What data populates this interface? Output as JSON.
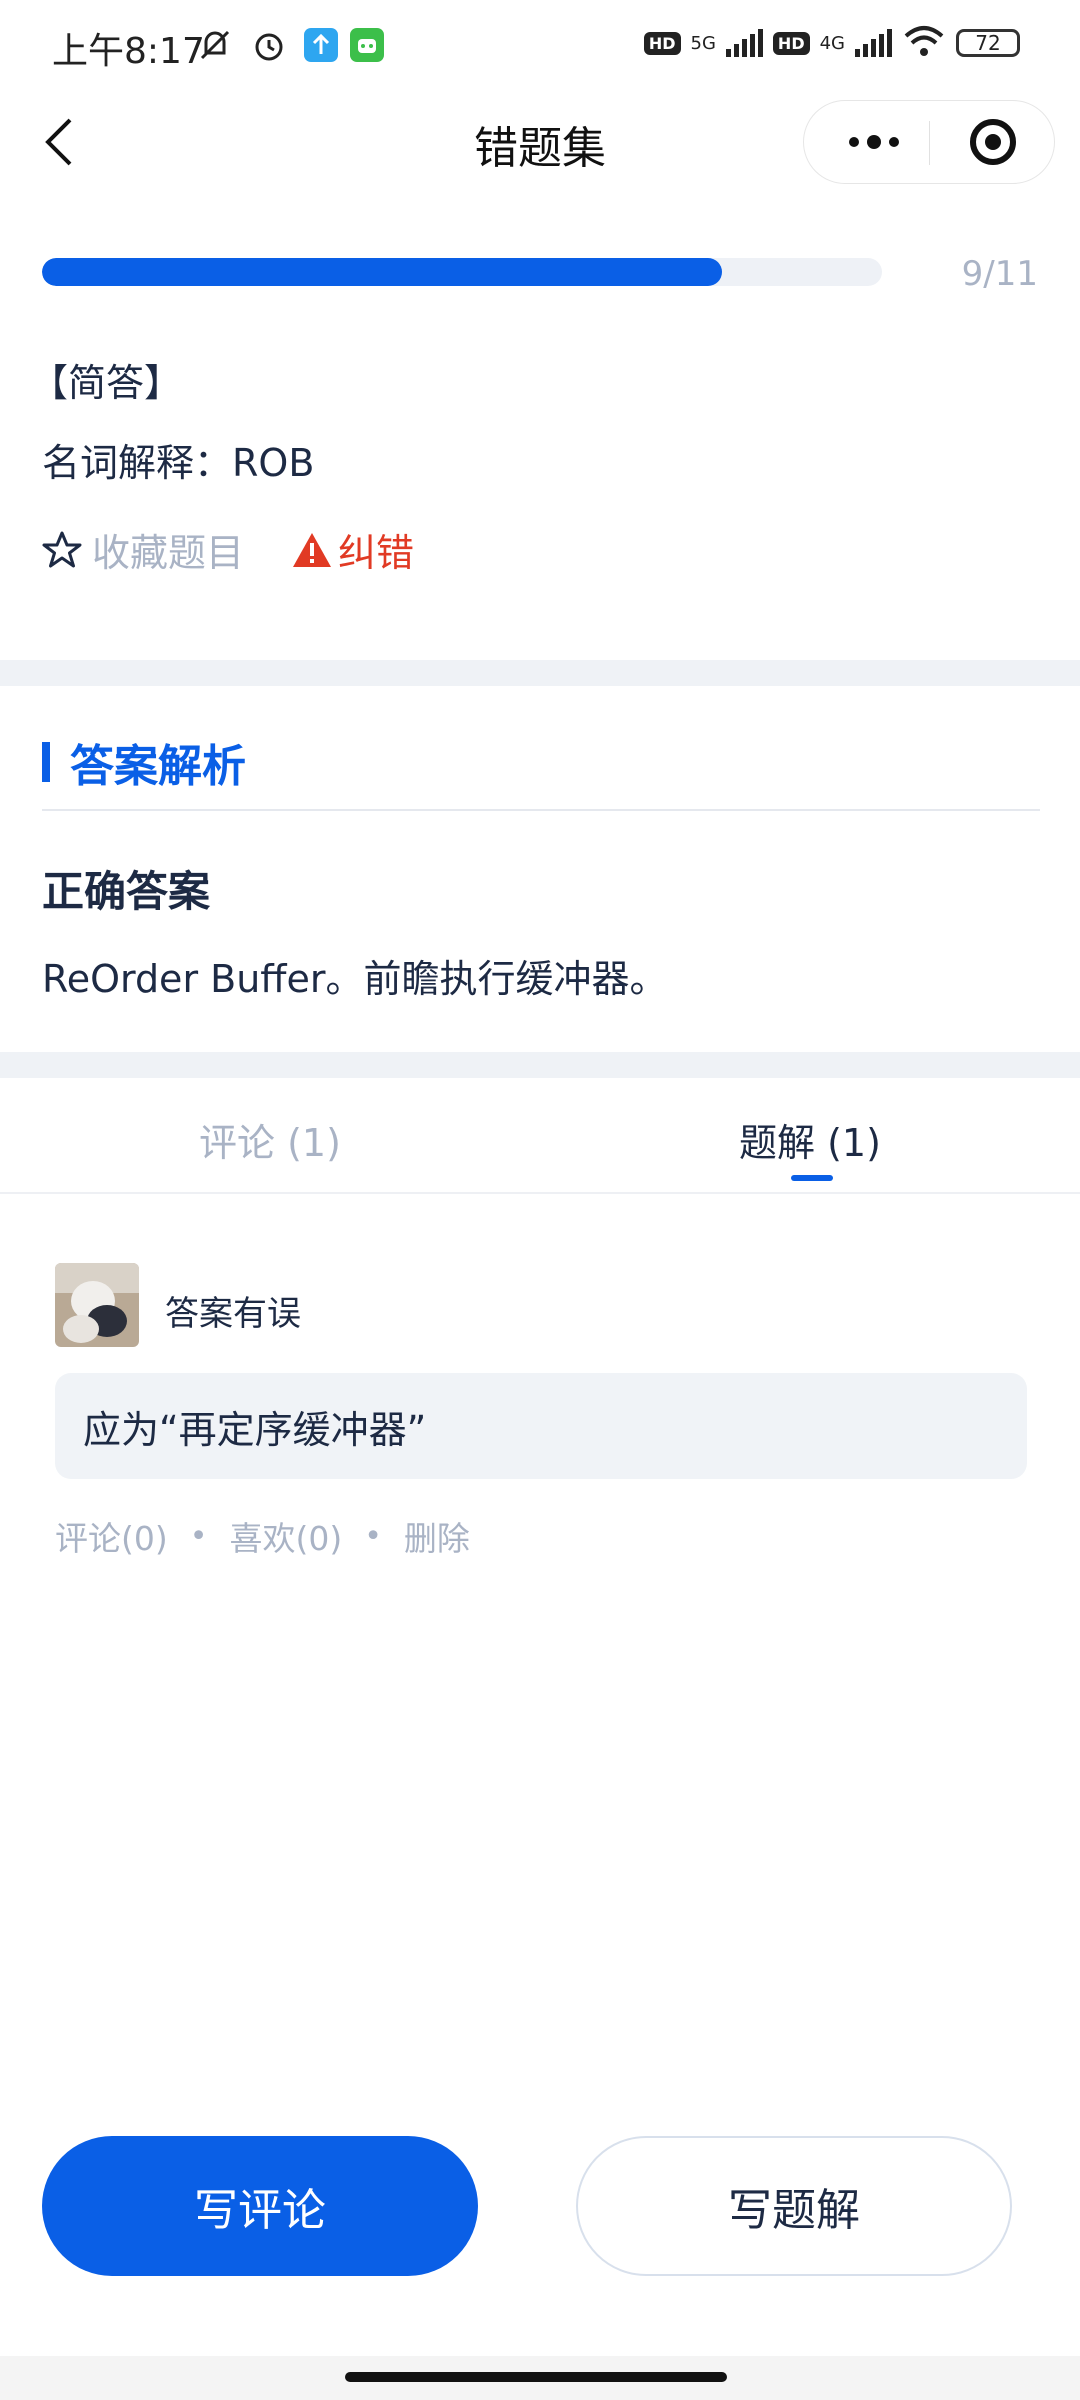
{
  "status_bar": {
    "time": "上午8:17",
    "network_1": "5G",
    "network_2": "4G",
    "hd_label": "HD",
    "battery": "72",
    "icons": [
      "mute-icon",
      "alarm-icon",
      "upload-app-icon",
      "robot-app-icon",
      "wifi-icon"
    ]
  },
  "nav": {
    "title": "错题集"
  },
  "progress": {
    "current": 9,
    "total": 11,
    "label": "9/11",
    "fill_fraction": 0.81
  },
  "question": {
    "type": "【简答】",
    "text": "名词解释：ROB",
    "favorite_label": "收藏题目",
    "report_label": "纠错"
  },
  "answer": {
    "section_title": "答案解析",
    "label": "正确答案",
    "text": "ReOrder Buffer。前瞻执行缓冲器。"
  },
  "tabs": {
    "comments": "评论 (1)",
    "solutions": "题解 (1)",
    "active": "solutions"
  },
  "solution": {
    "title": "答案有误",
    "body": "应为“再定序缓冲器”",
    "comments": "评论(0)",
    "likes": "喜欢(0)",
    "delete": "删除",
    "separator": "•"
  },
  "buttons": {
    "write_comment": "写评论",
    "write_solution": "写题解"
  },
  "colors": {
    "accent": "#0a5fe6",
    "danger": "#e13a24",
    "muted": "#a9b3c5",
    "text": "#1d2a44"
  }
}
